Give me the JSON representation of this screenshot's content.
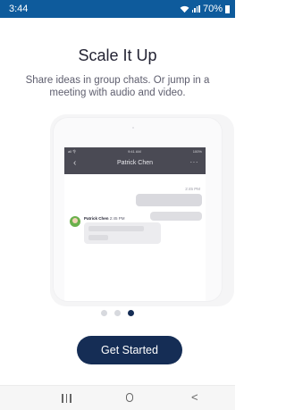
{
  "status_bar": {
    "time": "3:44",
    "battery": "70%",
    "icons": [
      "wifi-icon",
      "signal-icon",
      "battery-icon"
    ]
  },
  "onboarding": {
    "title": "Scale It Up",
    "subtitle": "Share ideas in group chats. Or jump in a meeting with audio and video.",
    "page_index": 3,
    "page_count": 3,
    "get_started_label": "Get Started"
  },
  "mockup": {
    "status_left": "all 令",
    "status_time": "9:41 AM",
    "status_right": "100%",
    "chat_title": "Patrick Chen",
    "back_icon": "‹",
    "more_icon": "···",
    "outgoing_time": "2:45 PM",
    "sender_name": "Patrick Chen",
    "sender_time": "2:45 PM"
  },
  "nav_bar": {
    "icons": [
      "recents-icon",
      "home-icon",
      "back-icon"
    ],
    "back_glyph": "<"
  },
  "colors": {
    "status_bar": "#0e5b9c",
    "primary_button": "#152d55",
    "active_dot": "#152d55",
    "inactive_dot": "#d7d9de"
  }
}
